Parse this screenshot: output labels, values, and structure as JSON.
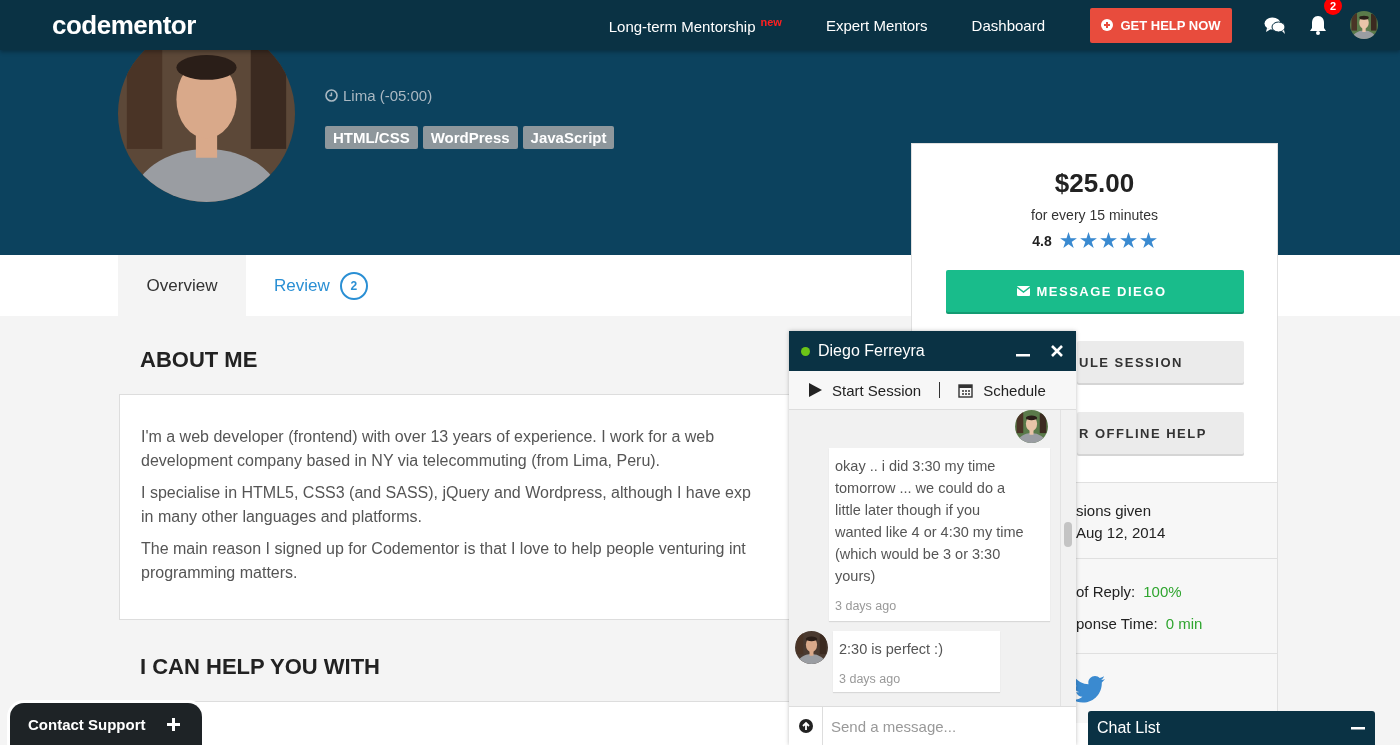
{
  "nav": {
    "logo": "codementor",
    "links": [
      {
        "label": "Long-term Mentorship",
        "badge": "new"
      },
      {
        "label": "Expert Mentors"
      },
      {
        "label": "Dashboard"
      }
    ],
    "cta": "GET HELP NOW",
    "notifications": "2"
  },
  "profile": {
    "location": "Lima (-05:00)",
    "skills": [
      "HTML/CSS",
      "WordPress",
      "JavaScript"
    ]
  },
  "tabs": [
    {
      "label": "Overview",
      "selected": true
    },
    {
      "label": "Review",
      "count": "2",
      "selected": false
    }
  ],
  "about": {
    "heading": "ABOUT ME",
    "paragraphs": [
      "I'm a web developer (frontend) with over 13 years of experience. I work for a web\ndevelopment company based in NY via telecommuting (from Lima, Peru).",
      "I specialise in HTML5, CSS3 (and SASS), jQuery and Wordpress, although I have exp\nin many other languages and platforms.",
      "The main reason I signed up for Codementor is that I love to help people venturing int\nprogramming matters."
    ]
  },
  "help": {
    "heading": "I CAN HELP YOU WITH"
  },
  "pricing": {
    "price": "$25.00",
    "unit": "for every 15 minutes",
    "rating": "4.8",
    "stars": 5,
    "buttons": [
      {
        "label": "MESSAGE DIEGO",
        "kind": "primary"
      },
      {
        "label": "ULE SESSION",
        "kind": "secondary"
      },
      {
        "label": "R OFFLINE HELP",
        "kind": "secondary"
      }
    ],
    "stats": [
      [
        {
          "label": "sions given"
        },
        {
          "label": "Aug 12, 2014"
        }
      ],
      [
        {
          "label": "of Reply:",
          "value": "100%"
        },
        {
          "label": "ponse Time:",
          "value": "0 min"
        }
      ]
    ]
  },
  "chat": {
    "name": "Diego Ferreyra",
    "online": true,
    "actions": [
      {
        "label": "Start Session",
        "kind": "play"
      },
      {
        "label": "Schedule",
        "kind": "calendar"
      }
    ],
    "messages": [
      {
        "kind": "sent",
        "text": "okay .. i did 3:30 my time\ntomorrow ... we could do a\nlittle later though if you\nwanted like 4 or 4:30 my time\n(which would be 3 or 3:30\nyours)",
        "time": "3 days ago"
      },
      {
        "kind": "received",
        "text": "2:30 is perfect :)",
        "time": "3 days ago"
      }
    ],
    "placeholder": "Send a message..."
  },
  "contact_support": "Contact Support",
  "chat_list": "Chat List"
}
